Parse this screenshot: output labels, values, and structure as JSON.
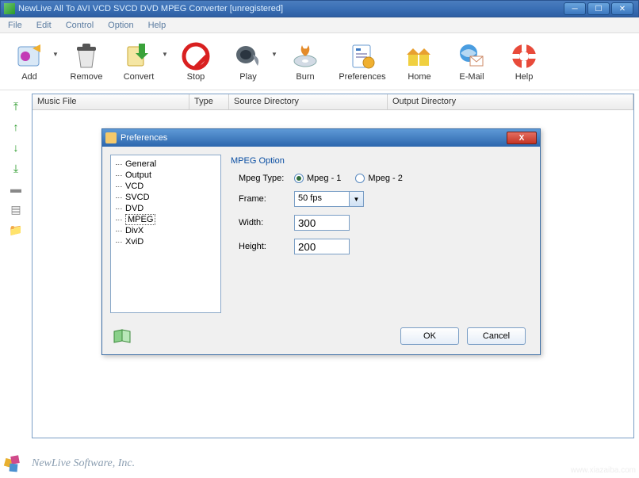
{
  "window": {
    "title": "NewLive All To AVI VCD SVCD DVD MPEG Converter  [unregistered]"
  },
  "menu": {
    "items": [
      "File",
      "Edit",
      "Control",
      "Option",
      "Help"
    ]
  },
  "toolbar": {
    "items": [
      {
        "label": "Add",
        "icon": "add-icon",
        "dropdown": true
      },
      {
        "label": "Remove",
        "icon": "remove-icon",
        "dropdown": false
      },
      {
        "label": "Convert",
        "icon": "convert-icon",
        "dropdown": true
      },
      {
        "label": "Stop",
        "icon": "stop-icon",
        "dropdown": false
      },
      {
        "label": "Play",
        "icon": "play-icon",
        "dropdown": true
      },
      {
        "label": "Burn",
        "icon": "burn-icon",
        "dropdown": false
      },
      {
        "label": "Preferences",
        "icon": "preferences-icon",
        "dropdown": false
      },
      {
        "label": "Home",
        "icon": "home-icon",
        "dropdown": false
      },
      {
        "label": "E-Mail",
        "icon": "email-icon",
        "dropdown": false
      },
      {
        "label": "Help",
        "icon": "help-icon",
        "dropdown": false
      }
    ]
  },
  "table": {
    "columns": [
      "Music File",
      "Type",
      "Source Directory",
      "Output Directory"
    ]
  },
  "dialog": {
    "title": "Preferences",
    "tree": [
      "General",
      "Output",
      "VCD",
      "SVCD",
      "DVD",
      "MPEG",
      "DivX",
      "XviD"
    ],
    "selected_tree": "MPEG",
    "group": "MPEG Option",
    "mpeg_type_label": "Mpeg Type:",
    "mpeg1_label": "Mpeg - 1",
    "mpeg2_label": "Mpeg - 2",
    "mpeg_type_selected": "Mpeg - 1",
    "frame_label": "Frame:",
    "frame_value": "50 fps",
    "width_label": "Width:",
    "width_value": "300",
    "height_label": "Height:",
    "height_value": "200",
    "ok_label": "OK",
    "cancel_label": "Cancel"
  },
  "footer": {
    "company": "NewLive Software, Inc."
  },
  "watermark": "www.xiazaiba.com"
}
